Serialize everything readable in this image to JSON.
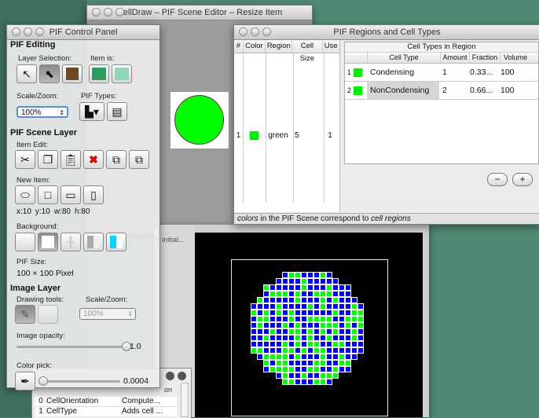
{
  "colors": {
    "desktop": "#4f8b74",
    "cell_blue": "#0000ff",
    "cell_green": "#00ff00",
    "accent_cyan": "#00d8ff"
  },
  "scene_editor": {
    "title": "CellDraw – PIF Scene Editor – Resize Item"
  },
  "lower_window": {
    "partial_label": "IF initial...",
    "header_frag": "on"
  },
  "control_panel": {
    "title": "PIF Control Panel",
    "pif_editing": "PIF Editing",
    "layer_selection": "Layer Selection:",
    "item_is": "Item is:",
    "scale_zoom": "Scale/Zoom:",
    "pif_types": "PIF Types:",
    "zoom_value": "100%",
    "scene_layer": "PIF Scene Layer",
    "item_edit": "Item Edit:",
    "new_item": "New Item:",
    "coords": {
      "x": "x:10",
      "y": "y:10",
      "w": "w:80",
      "h": "h:80"
    },
    "background": "Background:",
    "pif_size": "PIF Size:",
    "pif_size_value": "100 × 100 Pixel",
    "image_layer": "Image Layer",
    "drawing_tools": "Drawing tools:",
    "image_scale_zoom": "Scale/Zoom:",
    "image_zoom_value": "100%",
    "image_opacity": "Image opacity:",
    "opacity_value": "1.0",
    "color_pick": "Color pick:",
    "color_pick_value": "0.0004"
  },
  "regions": {
    "title": "PIF Regions and Cell Types",
    "headers": {
      "num": "#",
      "color": "Color",
      "region": "Region",
      "cell_size": "Cell Size",
      "use": "Use"
    },
    "row": {
      "num": "1",
      "region": "green",
      "cell_size": "5",
      "use": "1"
    },
    "sub_title": "Cell Types in Region",
    "sub_headers": {
      "cell_type": "Cell Type",
      "amount": "Amount",
      "fraction": "Fraction",
      "volume": "Volume"
    },
    "cell_types": [
      {
        "num": "1",
        "name": "Condensing",
        "amount": "1",
        "fraction": "0.33...",
        "volume": "100"
      },
      {
        "num": "2",
        "name": "NonCondensing",
        "amount": "2",
        "fraction": "0.66...",
        "volume": "100"
      }
    ],
    "remove_btn": "−",
    "add_btn": "+",
    "status": {
      "a": "colors",
      "b": " in the PIF Scene correspond to ",
      "c": "cell regions"
    }
  },
  "plugin_table": {
    "rows": [
      {
        "num": "0",
        "name": "CellOrientation",
        "val": "Compute..."
      },
      {
        "num": "1",
        "name": "CellType",
        "val": "Adds cell ..."
      }
    ]
  }
}
